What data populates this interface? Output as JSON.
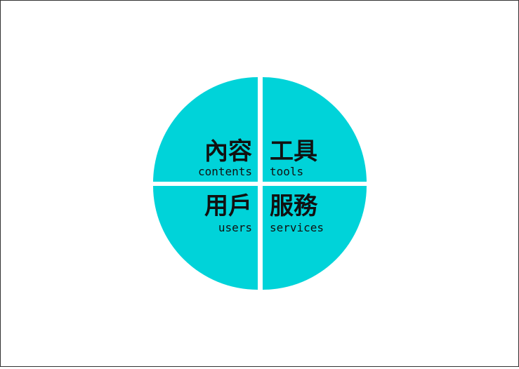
{
  "colors": {
    "quadrant_fill": "#00d3d9",
    "divider": "#ffffff",
    "frame_border": "#333333",
    "text": "#111111"
  },
  "quadrants": {
    "top_left": {
      "title": "內容",
      "subtitle": "contents"
    },
    "top_right": {
      "title": "工具",
      "subtitle": "tools"
    },
    "bottom_left": {
      "title": "用戶",
      "subtitle": "users"
    },
    "bottom_right": {
      "title": "服務",
      "subtitle": "services"
    }
  }
}
